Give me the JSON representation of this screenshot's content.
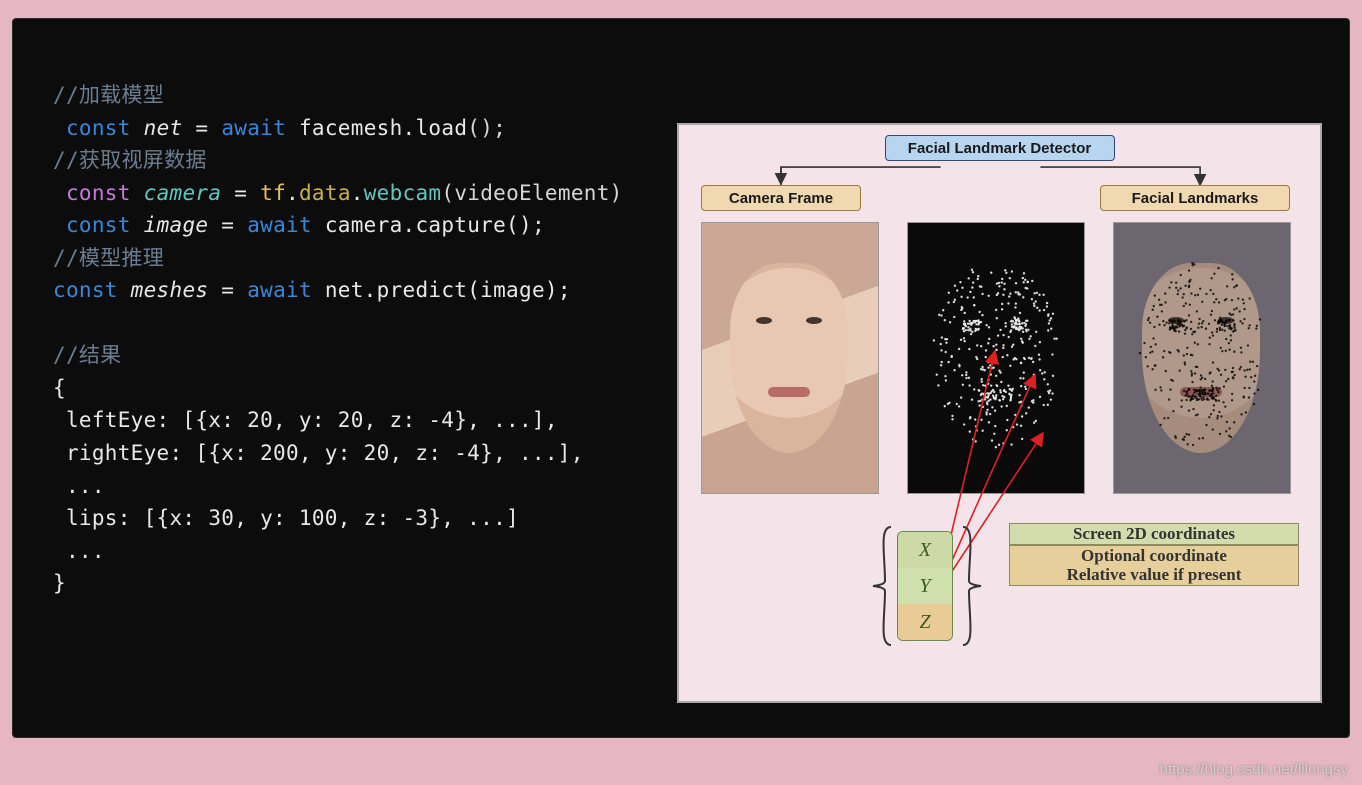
{
  "code": {
    "c1": "//加载模型",
    "l2_kw": "const",
    "l2_id": "net",
    "l2_eq": " = ",
    "l2_aw": "await",
    "l2_call": " facemesh",
    "l2_dot": ".",
    "l2_fn": "load",
    "l2_endp": "();",
    "c2": "//获取视屏数据",
    "l4_kw": "const",
    "l4_id": "camera",
    "l4_eq": " = ",
    "l4_ns1": "tf",
    "l4_d1": ".",
    "l4_ns2": "data",
    "l4_d2": ".",
    "l4_fn": "webcam",
    "l4_arg": "(videoElement)",
    "l5_kw": "const",
    "l5_id": "image",
    "l5_eq": " = ",
    "l5_aw": "await",
    "l5_expr": " camera.capture();",
    "c3": "//模型推理",
    "l7_kw": "const",
    "l7_id": "meshes",
    "l7_eq": " = ",
    "l7_aw": "await",
    "l7_expr": " net.predict(image);",
    "c4": "//结果",
    "brace_open": "{",
    "r1": " leftEye: [{x: 20, y: 20, z: -4}, ...],",
    "r2": " rightEye: [{x: 200, y: 20, z: -4}, ...],",
    "dots1": " ...",
    "r3": " lips: [{x: 30, y: 100, z: -3}, ...]",
    "dots2": " ...",
    "brace_close": "}"
  },
  "diagram": {
    "top": "Facial Landmark Detector",
    "left_label": "Camera Frame",
    "right_label": "Facial Landmarks",
    "coord": {
      "x": "X",
      "y": "Y",
      "z": "Z"
    },
    "desc1": "Screen 2D coordinates",
    "desc2a": "Optional coordinate",
    "desc2b": "Relative value if present"
  },
  "watermark": "https://blog.csdn.net/lilongsy"
}
